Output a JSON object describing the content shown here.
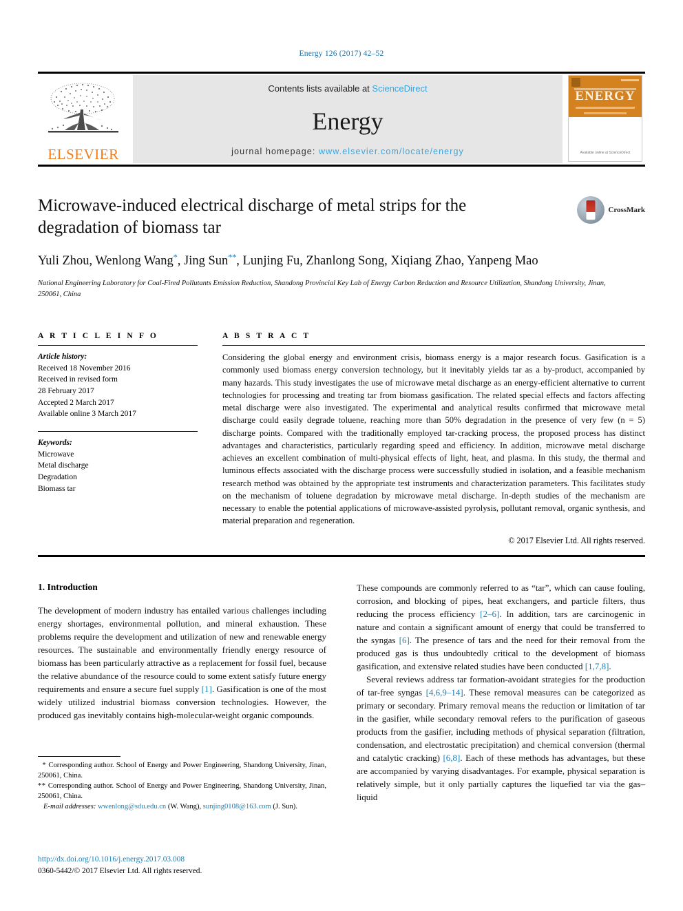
{
  "running_head": "Energy 126 (2017) 42–52",
  "masthead": {
    "contents_prefix": "Contents lists available at ",
    "sciencedirect": "ScienceDirect",
    "journal_name": "Energy",
    "homepage_label": "journal homepage: ",
    "homepage_url": "www.elsevier.com/locate/energy",
    "publisher": "ELSEVIER",
    "cover_title": "ENERGY",
    "cover_footer": "Available online at\nScienceDirect",
    "logo_icon": "elsevier-tree-logo"
  },
  "article": {
    "title": "Microwave-induced electrical discharge of metal strips for the degradation of biomass tar",
    "authors_line1": "Yuli Zhou, Wenlong Wang",
    "authors_mark1": "*",
    "authors_line1b": ", Jing Sun",
    "authors_mark2": "**",
    "authors_line1c": ", Lunjing Fu, Zhanlong Song, Xiqiang Zhao,",
    "authors_line2": "Yanpeng Mao",
    "affiliation": "National Engineering Laboratory for Coal-Fired Pollutants Emission Reduction, Shandong Provincial Key Lab of Energy Carbon Reduction and Resource Utilization, Shandong University, Jinan, 250061, China",
    "crossmark_label": "CrossMark"
  },
  "article_info": {
    "heading": "A R T I C L E    I N F O",
    "history_label": "Article history:",
    "history": [
      "Received 18 November 2016",
      "Received in revised form",
      "28 February 2017",
      "Accepted 2 March 2017",
      "Available online 3 March 2017"
    ],
    "keywords_label": "Keywords:",
    "keywords": [
      "Microwave",
      "Metal discharge",
      "Degradation",
      "Biomass tar"
    ]
  },
  "abstract": {
    "heading": "A B S T R A C T",
    "text": "Considering the global energy and environment crisis, biomass energy is a major research focus. Gasification is a commonly used biomass energy conversion technology, but it inevitably yields tar as a by-product, accompanied by many hazards. This study investigates the use of microwave metal discharge as an energy-efficient alternative to current technologies for processing and treating tar from biomass gasification. The related special effects and factors affecting metal discharge were also investigated. The experimental and analytical results confirmed that microwave metal discharge could easily degrade toluene, reaching more than 50% degradation in the presence of very few (n = 5) discharge points. Compared with the traditionally employed tar-cracking process, the proposed process has distinct advantages and characteristics, particularly regarding speed and efficiency. In addition, microwave metal discharge achieves an excellent combination of multi-physical effects of light, heat, and plasma. In this study, the thermal and luminous effects associated with the discharge process were successfully studied in isolation, and a feasible mechanism research method was obtained by the appropriate test instruments and characterization parameters. This facilitates study on the mechanism of toluene degradation by microwave metal discharge. In-depth studies of the mechanism are necessary to enable the potential applications of microwave-assisted pyrolysis, pollutant removal, organic synthesis, and material preparation and regeneration.",
    "copyright": "© 2017 Elsevier Ltd. All rights reserved."
  },
  "body": {
    "section_heading": "1. Introduction",
    "left_paragraph_1_a": "The development of modern industry has entailed various challenges including energy shortages, environmental pollution, and mineral exhaustion. These problems require the development and utilization of new and renewable energy resources. The sustainable and environmentally friendly energy resource of biomass has been particularly attractive as a replacement for fossil fuel, because the relative abundance of the resource could to some extent satisfy future energy requirements and ensure a secure fuel supply ",
    "left_paragraph_1_ref": "[1]",
    "left_paragraph_1_b": ". Gasification is one of the most widely utilized industrial biomass conversion technologies. However, the produced gas inevitably contains high-molecular-weight organic compounds.",
    "right_p1_a": "These compounds are commonly referred to as “tar”, which can cause fouling, corrosion, and blocking of pipes, heat exchangers, and particle filters, thus reducing the process efficiency ",
    "right_p1_ref1": "[2–6]",
    "right_p1_b": ". In addition, tars are carcinogenic in nature and contain a significant amount of energy that could be transferred to the syngas ",
    "right_p1_ref2": "[6]",
    "right_p1_c": ". The presence of tars and the need for their removal from the produced gas is thus undoubtedly critical to the development of biomass gasification, and extensive related studies have been conducted ",
    "right_p1_ref3": "[1,7,8]",
    "right_p1_d": ".",
    "right_p2_a": "Several reviews address tar formation-avoidant strategies for the production of tar-free syngas ",
    "right_p2_ref1": "[4,6,9–14]",
    "right_p2_b": ". These removal measures can be categorized as primary or secondary. Primary removal means the reduction or limitation of tar in the gasifier, while secondary removal refers to the purification of gaseous products from the gasifier, including methods of physical separation (filtration, condensation, and electrostatic precipitation) and chemical conversion (thermal and catalytic cracking) ",
    "right_p2_ref2": "[6,8]",
    "right_p2_c": ". Each of these methods has advantages, but these are accompanied by varying disadvantages. For example, physical separation is relatively simple, but it only partially captures the liquefied tar via the gas–liquid"
  },
  "footnotes": {
    "note1_mark": "*",
    "note1": " Corresponding author. School of Energy and Power Engineering, Shandong University, Jinan, 250061, China.",
    "note2_mark": "**",
    "note2": " Corresponding author. School of Energy and Power Engineering, Shandong University, Jinan, 250061, China.",
    "email_label": "E-mail addresses:",
    "email1": "wwenlong@sdu.edu.cn",
    "email1_owner": " (W. Wang), ",
    "email2": "sunjing0108@163.com",
    "email2_owner": " (J. Sun)."
  },
  "doi_block": {
    "doi": "http://dx.doi.org/10.1016/j.energy.2017.03.008",
    "issn_line": "0360-5442/© 2017 Elsevier Ltd. All rights reserved."
  },
  "colors": {
    "link": "#1a7fb5",
    "accent_orange": "#f07c1a",
    "cover_orange": "#d4821f",
    "masthead_gray": "#e6e6e6"
  }
}
